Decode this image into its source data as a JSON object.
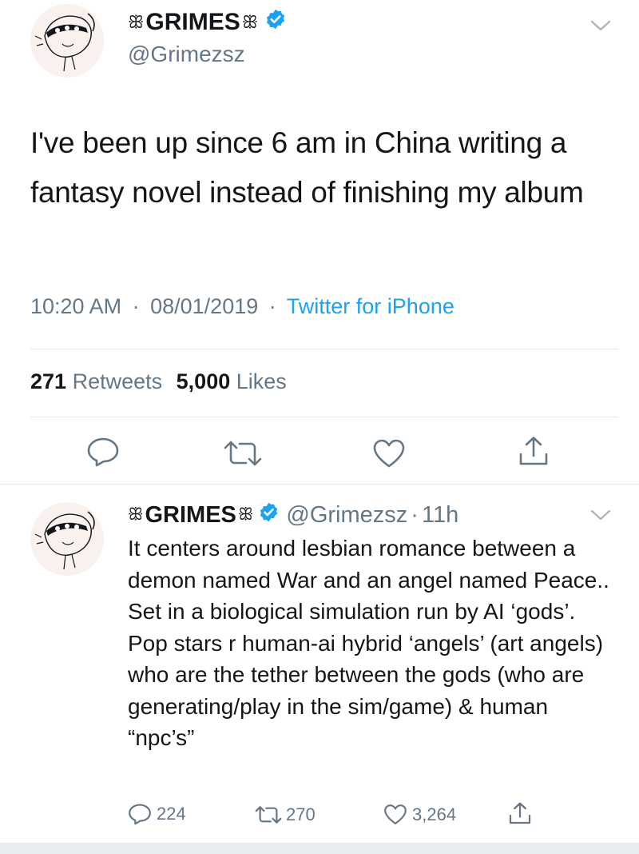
{
  "colors": {
    "text": "#14171a",
    "secondary": "#657786",
    "link": "#1da1f2",
    "verified": "#1da1f2",
    "divider": "#e1e8ed"
  },
  "main_tweet": {
    "display_name": "GRIMES",
    "ornament_left": "ꕥ",
    "ornament_right": "ꕥ",
    "handle": "@Grimezsz",
    "text": "I've been up since 6 am in China writing a fantasy novel instead of finishing my album",
    "time": "10:20 AM",
    "date": "08/01/2019",
    "source": "Twitter for iPhone",
    "separator": "·",
    "retweets_count": "271",
    "retweets_label": "Retweets",
    "likes_count": "5,000",
    "likes_label": "Likes",
    "icons": [
      "reply-icon",
      "retweet-icon",
      "like-icon",
      "share-icon"
    ]
  },
  "reply_tweet": {
    "display_name": "GRIMES",
    "handle": "@Grimezsz",
    "separator": "·",
    "age": "11h",
    "text": "It centers around lesbian romance between a demon named War and an angel named Peace.. Set in a biological simulation run by AI ‘gods’. Pop stars r human-ai hybrid ‘angels’ (art angels) who are the tether between the gods (who are generating/play in the sim/game) & human “npc’s”",
    "reply_count": "224",
    "retweet_count": "270",
    "like_count": "3,264"
  }
}
